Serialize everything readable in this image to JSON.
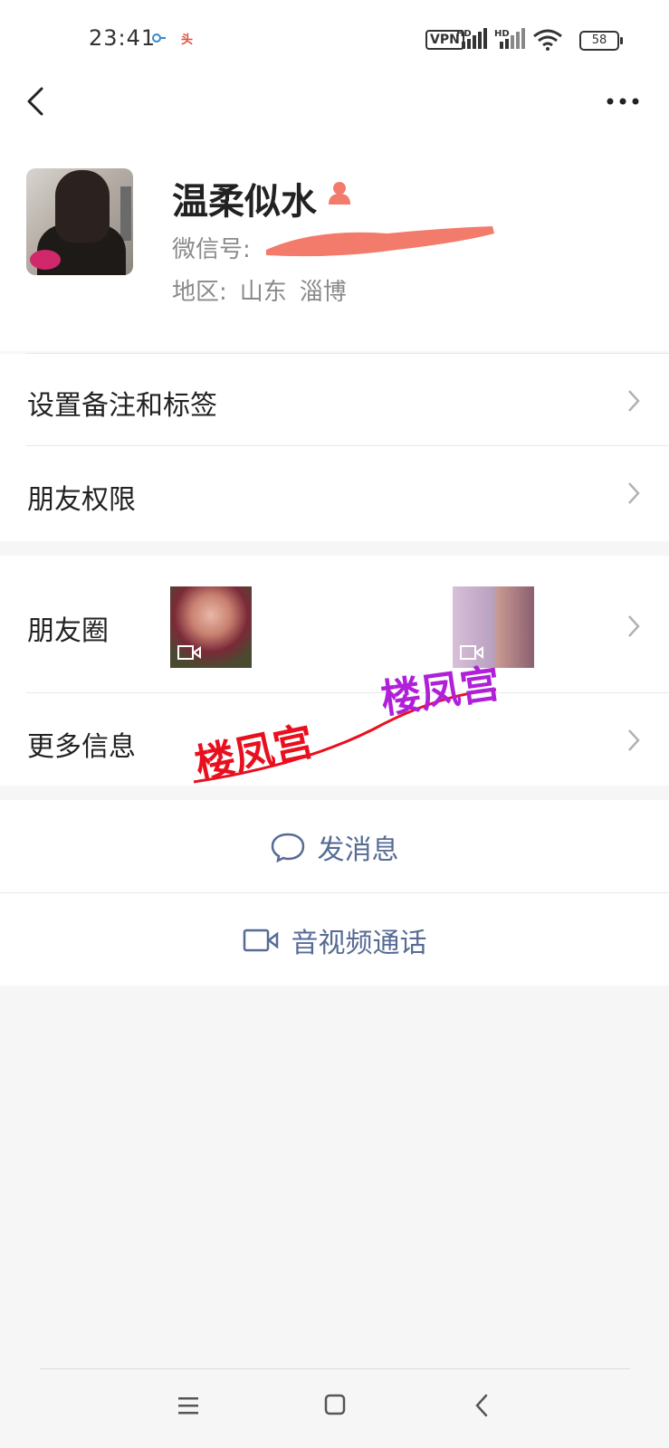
{
  "status_bar": {
    "time": "23:41",
    "app_badge": "头",
    "vpn": "VPN",
    "signal1": "HD",
    "signal2": "HD",
    "battery": "58"
  },
  "profile": {
    "name": "温柔似水",
    "wxid_label": "微信号:",
    "region_label": "地区:",
    "province": "山东",
    "city": "淄博",
    "gender_color": "#f37b6b"
  },
  "rows": {
    "remarks": "设置备注和标签",
    "permissions": "朋友权限",
    "moments": "朋友圈",
    "more_info": "更多信息"
  },
  "watermarks": [
    "楼凤宫",
    "楼凤宫"
  ],
  "actions": {
    "message": "发消息",
    "call": "音视频通话"
  },
  "colors": {
    "link": "#576b95"
  }
}
